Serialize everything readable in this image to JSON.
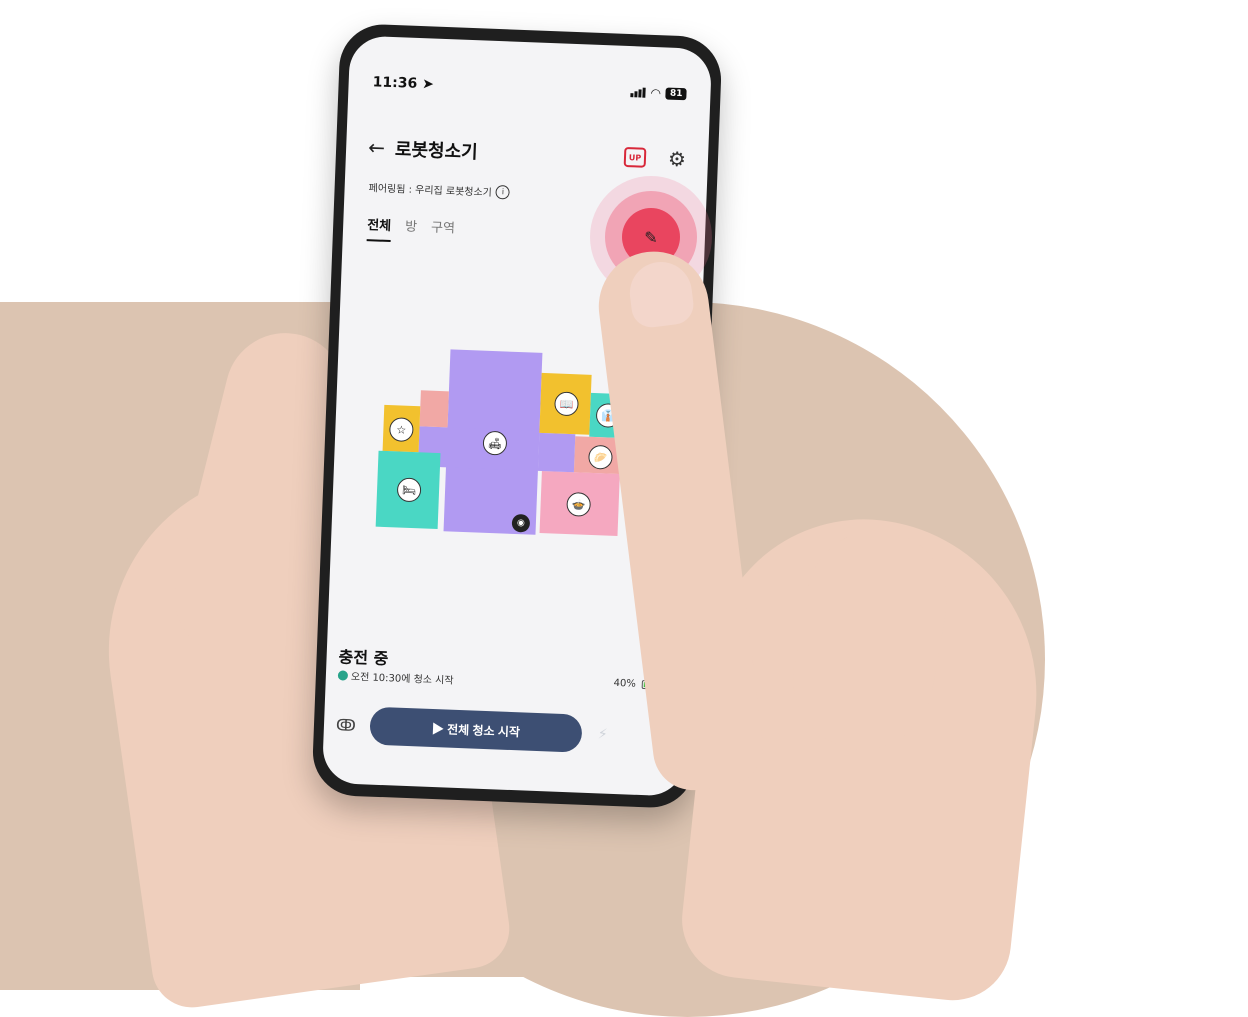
{
  "status_bar": {
    "time": "11:36 ➤",
    "battery": "81"
  },
  "header": {
    "title": "로봇청소기",
    "back_icon": "←",
    "up_badge": "UP",
    "settings_icon": "⚙"
  },
  "pairing": {
    "text": "페어링됨 : 우리집 로봇청소기",
    "info_icon": "i"
  },
  "tabs": [
    {
      "label": "전체",
      "active": true
    },
    {
      "label": "방",
      "active": false
    },
    {
      "label": "구역",
      "active": false
    }
  ],
  "map": {
    "rooms": [
      {
        "name": "living-room",
        "color": "#b19af2",
        "icon": "🛋"
      },
      {
        "name": "study",
        "color": "#f2c12e",
        "icon": "📖"
      },
      {
        "name": "dressroom",
        "color": "#4ad7c4",
        "icon": "👔"
      },
      {
        "name": "favorite",
        "color": "#f2c12e",
        "icon": "☆"
      },
      {
        "name": "bedroom",
        "color": "#4ad7c4",
        "icon": "🛏"
      },
      {
        "name": "balcony",
        "color": "#f1a8a5",
        "icon": "🥟"
      },
      {
        "name": "kitchen",
        "color": "#f5a8c0",
        "icon": "🍲"
      },
      {
        "name": "hall",
        "color": "#f1a8a5",
        "icon": ""
      }
    ],
    "robot_icon": "◉",
    "camera_icon": "◉"
  },
  "status": {
    "title": "충전 중",
    "schedule": "오전 10:30에 청소 시작",
    "battery": "40%"
  },
  "bottom": {
    "mode_icon": "ↂ",
    "start_label": "▶ 전체 청소 시작",
    "bolt_icon": "⚡"
  },
  "edit_icon": "✎"
}
